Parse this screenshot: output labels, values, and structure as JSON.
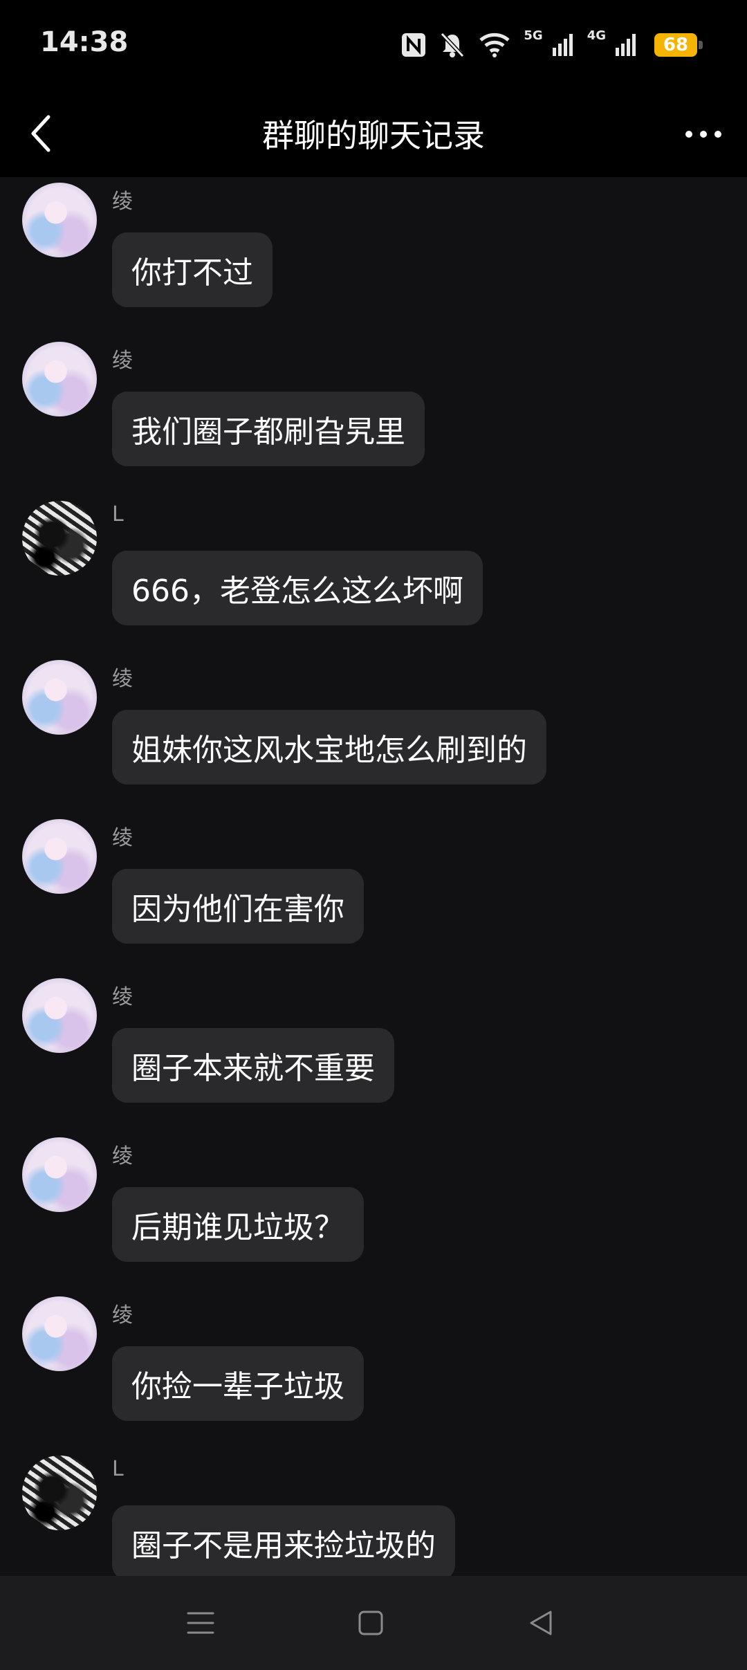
{
  "status_bar": {
    "time": "14:38",
    "icons": [
      "nfc-icon",
      "mute-bell-icon",
      "wifi-icon",
      "signal-5g-icon",
      "signal-4g-icon"
    ],
    "net1": "5G",
    "net2": "4G",
    "battery": "68",
    "battery_color": "#f4b400"
  },
  "header": {
    "title": "群聊的聊天记录",
    "back_icon": "back-chevron-icon",
    "more_icon": "more-dots-icon"
  },
  "messages": [
    {
      "sender": "绫",
      "text": "你打不过",
      "avatar": "a1"
    },
    {
      "sender": "绫",
      "text": "我们圈子都刷旮旯里",
      "avatar": "a1"
    },
    {
      "sender": "L",
      "text": "666，老登怎么这么坏啊",
      "avatar": "a2"
    },
    {
      "sender": "绫",
      "text": "姐妹你这风水宝地怎么刷到的",
      "avatar": "a1"
    },
    {
      "sender": "绫",
      "text": "因为他们在害你",
      "avatar": "a1"
    },
    {
      "sender": "绫",
      "text": "圈子本来就不重要",
      "avatar": "a1"
    },
    {
      "sender": "绫",
      "text": "后期谁见垃圾？",
      "avatar": "a1"
    },
    {
      "sender": "绫",
      "text": "你捡一辈子垃圾",
      "avatar": "a1"
    },
    {
      "sender": "L",
      "text": "圈子不是用来捡垃圾的",
      "avatar": "a2"
    }
  ],
  "nav_bar": {
    "icons": [
      "menu-icon",
      "home-square-icon",
      "back-triangle-icon"
    ]
  }
}
